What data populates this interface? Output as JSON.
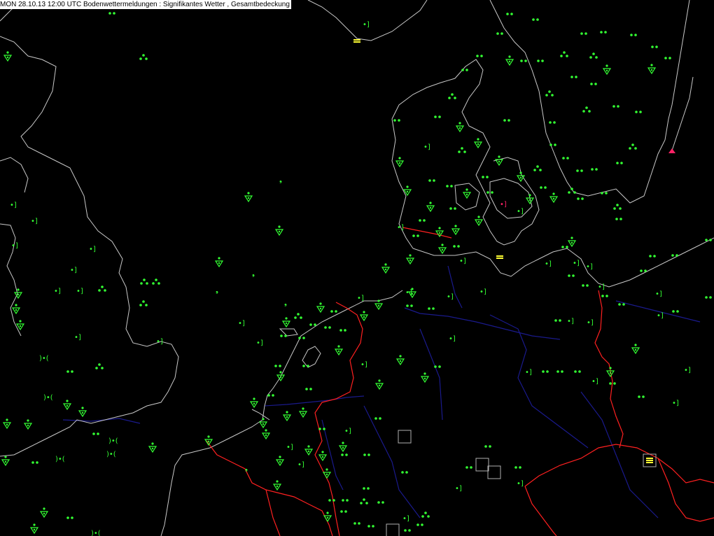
{
  "header": {
    "title": "MON 28.10.13 12:00 UTC  Bodenwettermeldungen :  Signifikantes Wetter , Gesamtbedeckung"
  },
  "colors": {
    "background": "#000000",
    "coastline": "#c8c8c8",
    "border": "#ff2020",
    "river": "#1a1a8c",
    "station": "#33ff33",
    "fog": "#ffff33",
    "thunder": "#ff2266",
    "box": "#b0b0b0"
  },
  "symbols": {
    "rain_dots": "rain-dots-icon",
    "showers": "rain-shower-icon",
    "rain_recent": "recent-rain-icon",
    "drizzle": "drizzle-icon",
    "fog": "fog-icon",
    "thunderstorm": "thunderstorm-icon"
  }
}
